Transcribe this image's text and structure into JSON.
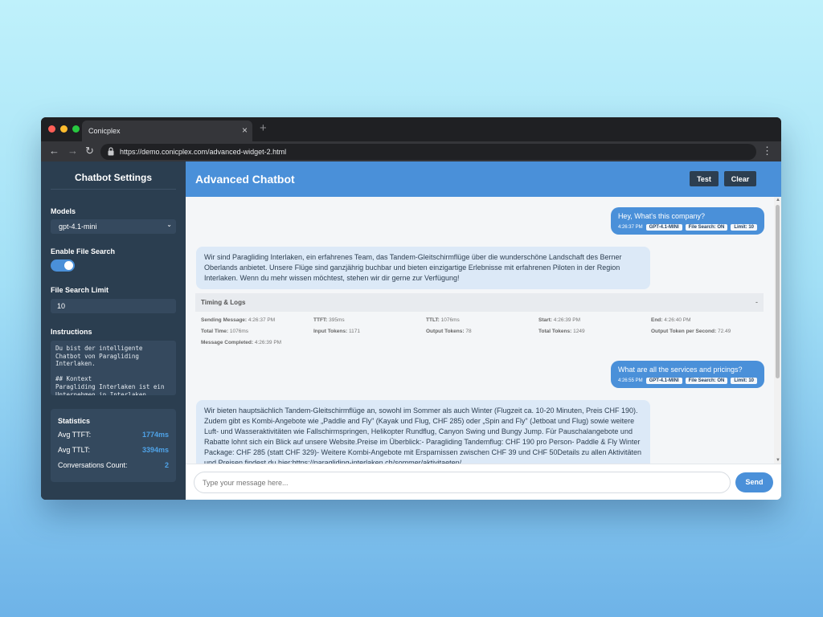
{
  "browser": {
    "tab_title": "Conicplex",
    "tab_close": "×",
    "new_tab": "+",
    "url": "https://demo.conicplex.com/advanced-widget-2.html",
    "traffic_colors": [
      "#ff5f57",
      "#febc2e",
      "#28c840"
    ]
  },
  "sidebar": {
    "title": "Chatbot Settings",
    "models_label": "Models",
    "model_value": "gpt-4.1-mini",
    "file_search_label": "Enable File Search",
    "file_search_on": true,
    "limit_label": "File Search Limit",
    "limit_value": "10",
    "instructions_label": "Instructions",
    "instructions_value": "Du bist der intelligente\nChatbot von Paragliding\nInterlaken.\n\n## Kontext\nParagliding Interlaken ist ein\nUnternehmen in Interlaken",
    "stats": {
      "title": "Statistics",
      "rows": [
        {
          "label": "Avg TTFT:",
          "value": "1774ms"
        },
        {
          "label": "Avg TTLT:",
          "value": "3394ms"
        },
        {
          "label": "Conversations Count:",
          "value": "2"
        }
      ]
    }
  },
  "main": {
    "title": "Advanced Chatbot",
    "test_label": "Test",
    "clear_label": "Clear",
    "input_placeholder": "Type your message here...",
    "send_label": "Send",
    "accent": "#4a90d9"
  },
  "messages": {
    "u1": {
      "text": "Hey, What's this company?",
      "time": "4:26:37 PM",
      "model": "GPT-4.1-MINI",
      "file_search": "File Search: ON",
      "limit": "Limit: 10"
    },
    "b1": {
      "text": "Wir sind Paragliding Interlaken, ein erfahrenes Team, das Tandem-Gleitschirmflüge über die wunderschöne Landschaft des Berner Oberlands anbietet. Unsere Flüge sind ganzjährig buchbar und bieten einzigartige Erlebnisse mit erfahrenen Piloten in der Region Interlaken. Wenn du mehr wissen möchtest, stehen wir dir gerne zur Verfügung!"
    },
    "timing": {
      "title": "Timing & Logs",
      "toggle": "-",
      "sending_label": "Sending Message:",
      "sending": "4:26:37 PM",
      "ttft_label": "TTFT:",
      "ttft": "395ms",
      "ttlt_label": "TTLT:",
      "ttlt": "1076ms",
      "start_label": "Start:",
      "start": "4:26:39 PM",
      "end_label": "End:",
      "end": "4:26:40 PM",
      "total_time_label": "Total Time:",
      "total_time": "1076ms",
      "input_tokens_label": "Input Tokens:",
      "input_tokens": "1171",
      "output_tokens_label": "Output Tokens:",
      "output_tokens": "78",
      "total_tokens_label": "Total Tokens:",
      "total_tokens": "1249",
      "otps_label": "Output Token per Second:",
      "otps": "72.49",
      "completed_label": "Message Completed:",
      "completed": "4:26:39 PM"
    },
    "u2": {
      "text": "What are all the services and pricings?",
      "time": "4:26:55 PM",
      "model": "GPT-4.1-MINI",
      "file_search": "File Search: ON",
      "limit": "Limit: 10"
    },
    "b2": {
      "text": "Wir bieten hauptsächlich Tandem-Gleitschirmflüge an, sowohl im Sommer als auch Winter (Flugzeit ca. 10-20 Minuten, Preis CHF 190). Zudem gibt es Kombi-Angebote wie „Paddle and Fly\" (Kayak und Flug, CHF 285) oder „Spin and Fly\" (Jetboat und Flug) sowie weitere Luft- und Wasseraktivitäten wie Fallschirmspringen, Helikopter Rundflug, Canyon Swing und Bungy Jump. Für Pauschalangebote und Rabatte lohnt sich ein Blick auf unsere Website.Preise im Überblick:- Paragliding Tandemflug: CHF 190 pro Person- Paddle & Fly Winter Package: CHF 285 (statt CHF 329)- Weitere Kombi-Angebote mit Ersparnissen zwischen CHF 39 und CHF 50Details zu allen Aktivitäten und Preisen findest du hier:https://paragliding-interlaken.ch/sommer/aktivitaeten/"
    }
  }
}
